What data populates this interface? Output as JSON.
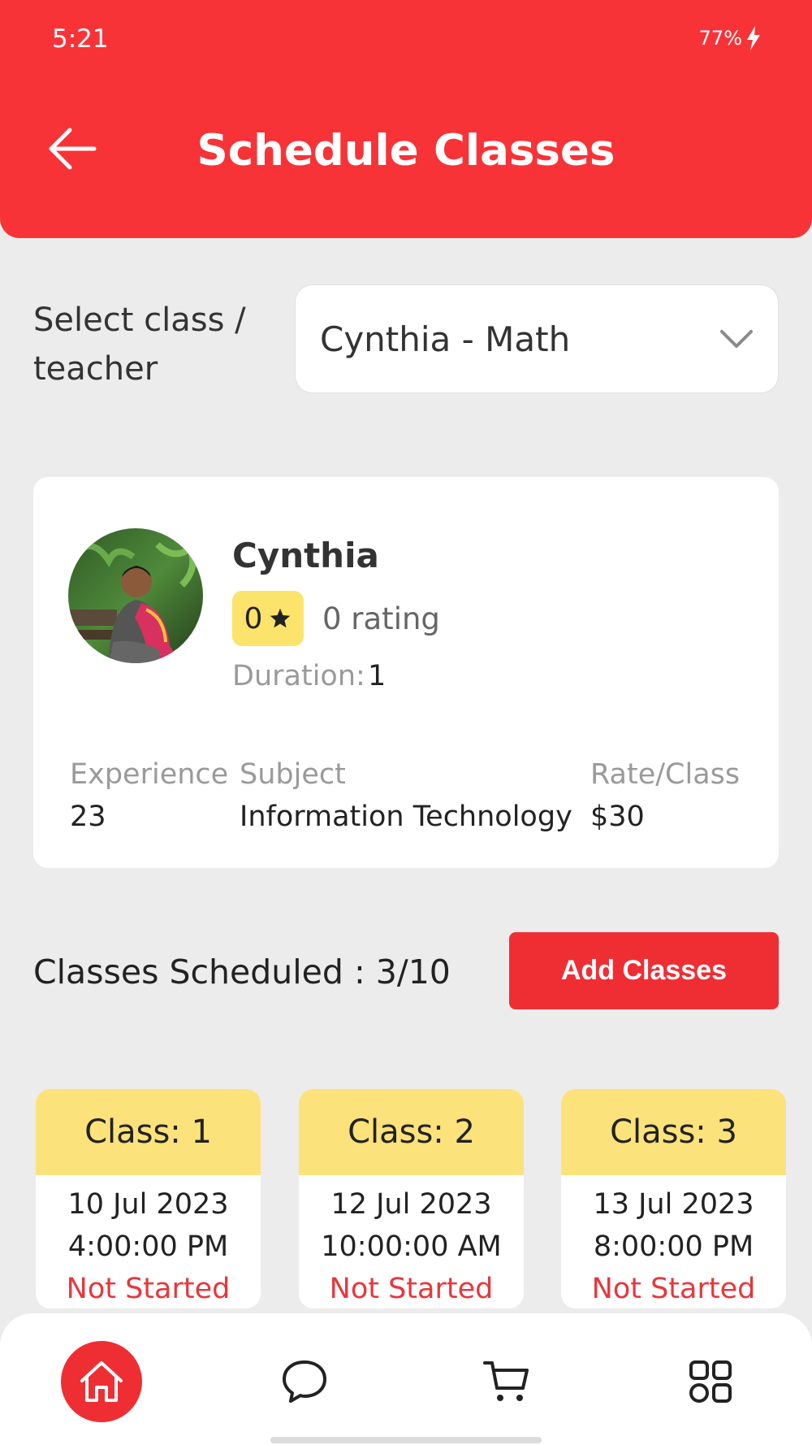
{
  "status_bar": {
    "time": "5:21",
    "battery": "77%"
  },
  "header": {
    "title": "Schedule Classes"
  },
  "select": {
    "label": "Select class / teacher",
    "value": "Cynthia - Math"
  },
  "teacher": {
    "name": "Cynthia",
    "rating_value": "0",
    "rating_text": "0 rating",
    "duration_label": "Duration:",
    "duration_value": "1",
    "experience_label": "Experience",
    "experience_value": "23",
    "subject_label": "Subject",
    "subject_value": "Information Technology",
    "rate_label": "Rate/Class",
    "rate_value": "$30"
  },
  "schedule": {
    "scheduled_text": "Classes Scheduled : 3/10",
    "add_button": "Add Classes"
  },
  "classes": [
    {
      "title": "Class: 1",
      "date": "10 Jul 2023",
      "time": "4:00:00 PM",
      "status": "Not Started"
    },
    {
      "title": "Class: 2",
      "date": "12 Jul 2023",
      "time": "10:00:00 AM",
      "status": "Not Started"
    },
    {
      "title": "Class: 3",
      "date": "13 Jul 2023",
      "time": "8:00:00 PM",
      "status": "Not Started"
    }
  ],
  "nav": {
    "items": [
      "home-icon",
      "chat-icon",
      "cart-icon",
      "grid-icon"
    ]
  },
  "colors": {
    "brand": "#f83338",
    "badge": "#fce36c",
    "status": "#e8363c"
  }
}
